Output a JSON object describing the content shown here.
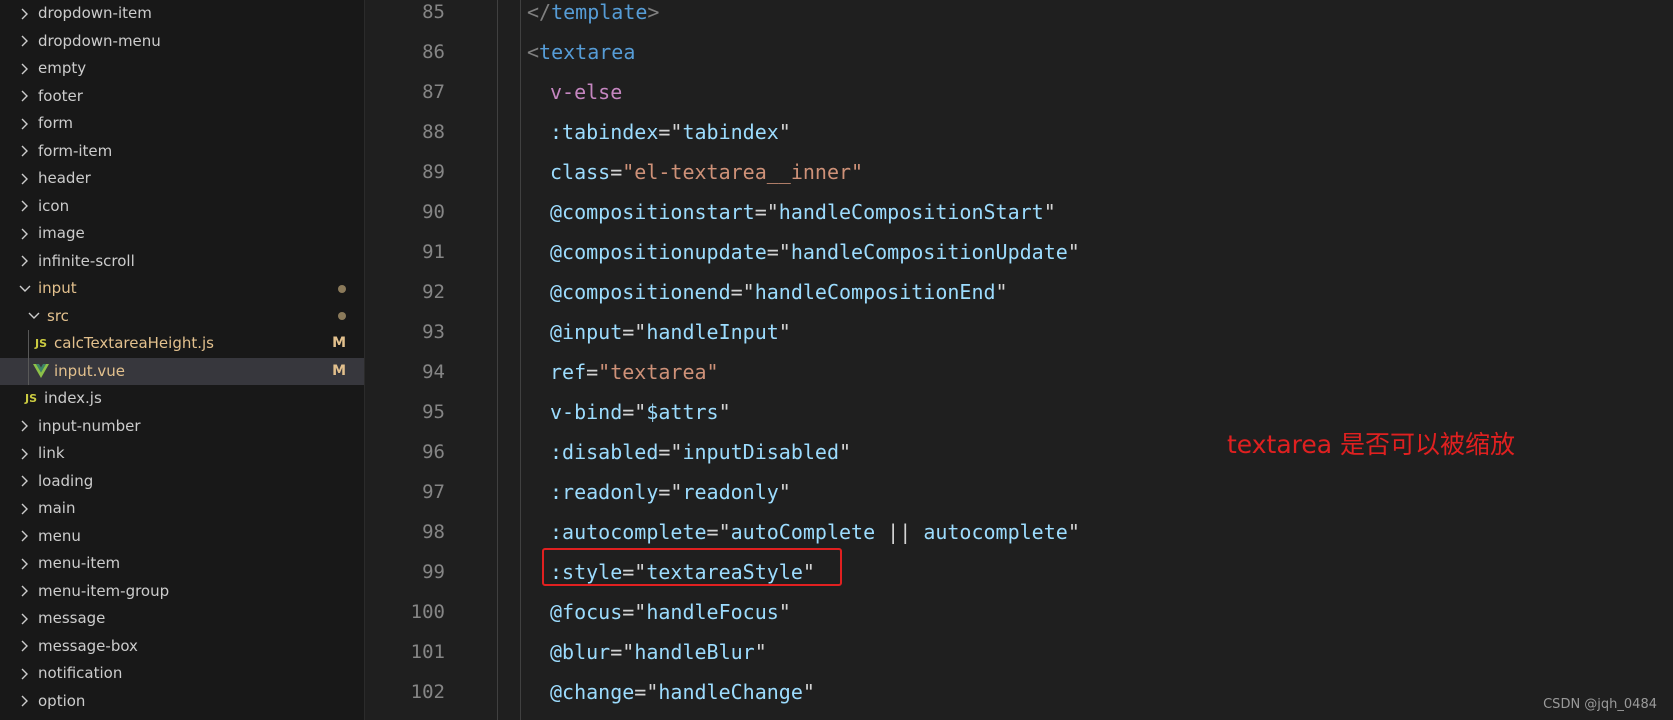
{
  "explorer": {
    "items": [
      {
        "label": "dropdown-item",
        "kind": "folder",
        "level": 0,
        "expanded": false
      },
      {
        "label": "dropdown-menu",
        "kind": "folder",
        "level": 0,
        "expanded": false
      },
      {
        "label": "empty",
        "kind": "folder",
        "level": 0,
        "expanded": false
      },
      {
        "label": "footer",
        "kind": "folder",
        "level": 0,
        "expanded": false
      },
      {
        "label": "form",
        "kind": "folder",
        "level": 0,
        "expanded": false
      },
      {
        "label": "form-item",
        "kind": "folder",
        "level": 0,
        "expanded": false
      },
      {
        "label": "header",
        "kind": "folder",
        "level": 0,
        "expanded": false
      },
      {
        "label": "icon",
        "kind": "folder",
        "level": 0,
        "expanded": false
      },
      {
        "label": "image",
        "kind": "folder",
        "level": 0,
        "expanded": false
      },
      {
        "label": "infinite-scroll",
        "kind": "folder",
        "level": 0,
        "expanded": false
      },
      {
        "label": "input",
        "kind": "folder",
        "level": 0,
        "expanded": true,
        "decoration": "dot"
      },
      {
        "label": "src",
        "kind": "folder",
        "level": 1,
        "expanded": true,
        "decoration": "dot"
      },
      {
        "label": "calcTextareaHeight.js",
        "kind": "js",
        "level": 2,
        "decoration": "M"
      },
      {
        "label": "input.vue",
        "kind": "vue",
        "level": 2,
        "decoration": "M",
        "selected": true
      },
      {
        "label": "index.js",
        "kind": "js",
        "level": 1
      },
      {
        "label": "input-number",
        "kind": "folder",
        "level": 0,
        "expanded": false
      },
      {
        "label": "link",
        "kind": "folder",
        "level": 0,
        "expanded": false
      },
      {
        "label": "loading",
        "kind": "folder",
        "level": 0,
        "expanded": false
      },
      {
        "label": "main",
        "kind": "folder",
        "level": 0,
        "expanded": false
      },
      {
        "label": "menu",
        "kind": "folder",
        "level": 0,
        "expanded": false
      },
      {
        "label": "menu-item",
        "kind": "folder",
        "level": 0,
        "expanded": false
      },
      {
        "label": "menu-item-group",
        "kind": "folder",
        "level": 0,
        "expanded": false
      },
      {
        "label": "message",
        "kind": "folder",
        "level": 0,
        "expanded": false
      },
      {
        "label": "message-box",
        "kind": "folder",
        "level": 0,
        "expanded": false
      },
      {
        "label": "notification",
        "kind": "folder",
        "level": 0,
        "expanded": false
      },
      {
        "label": "option",
        "kind": "folder",
        "level": 0,
        "expanded": false
      }
    ],
    "js_badge": "JS",
    "vue_badge": "V"
  },
  "editor": {
    "lines": [
      {
        "num": "85",
        "indent": 0,
        "tokens": [
          [
            "punc",
            "</"
          ],
          [
            "tag",
            "template"
          ],
          [
            "punc",
            ">"
          ]
        ]
      },
      {
        "num": "86",
        "indent": 0,
        "tokens": [
          [
            "punc",
            "<"
          ],
          [
            "tag",
            "textarea"
          ]
        ]
      },
      {
        "num": "87",
        "indent": 1,
        "tokens": [
          [
            "dir",
            "v-else"
          ]
        ]
      },
      {
        "num": "88",
        "indent": 1,
        "tokens": [
          [
            "attr",
            ":tabindex"
          ],
          [
            "eq",
            "="
          ],
          [
            "eq",
            "\""
          ],
          [
            "expr",
            "tabindex"
          ],
          [
            "eq",
            "\""
          ]
        ]
      },
      {
        "num": "89",
        "indent": 1,
        "tokens": [
          [
            "attr",
            "class"
          ],
          [
            "eq",
            "="
          ],
          [
            "str",
            "\"el-textarea__inner\""
          ]
        ]
      },
      {
        "num": "90",
        "indent": 1,
        "tokens": [
          [
            "attr",
            "@compositionstart"
          ],
          [
            "eq",
            "="
          ],
          [
            "eq",
            "\""
          ],
          [
            "expr",
            "handleCompositionStart"
          ],
          [
            "eq",
            "\""
          ]
        ]
      },
      {
        "num": "91",
        "indent": 1,
        "tokens": [
          [
            "attr",
            "@compositionupdate"
          ],
          [
            "eq",
            "="
          ],
          [
            "eq",
            "\""
          ],
          [
            "expr",
            "handleCompositionUpdate"
          ],
          [
            "eq",
            "\""
          ]
        ]
      },
      {
        "num": "92",
        "indent": 1,
        "tokens": [
          [
            "attr",
            "@compositionend"
          ],
          [
            "eq",
            "="
          ],
          [
            "eq",
            "\""
          ],
          [
            "expr",
            "handleCompositionEnd"
          ],
          [
            "eq",
            "\""
          ]
        ]
      },
      {
        "num": "93",
        "indent": 1,
        "tokens": [
          [
            "attr",
            "@input"
          ],
          [
            "eq",
            "="
          ],
          [
            "eq",
            "\""
          ],
          [
            "expr",
            "handleInput"
          ],
          [
            "eq",
            "\""
          ]
        ]
      },
      {
        "num": "94",
        "indent": 1,
        "tokens": [
          [
            "attr",
            "ref"
          ],
          [
            "eq",
            "="
          ],
          [
            "str",
            "\"textarea\""
          ]
        ]
      },
      {
        "num": "95",
        "indent": 1,
        "tokens": [
          [
            "attr",
            "v-bind"
          ],
          [
            "eq",
            "="
          ],
          [
            "eq",
            "\""
          ],
          [
            "expr",
            "$attrs"
          ],
          [
            "eq",
            "\""
          ]
        ]
      },
      {
        "num": "96",
        "indent": 1,
        "tokens": [
          [
            "attr",
            ":disabled"
          ],
          [
            "eq",
            "="
          ],
          [
            "eq",
            "\""
          ],
          [
            "expr",
            "inputDisabled"
          ],
          [
            "eq",
            "\""
          ]
        ]
      },
      {
        "num": "97",
        "indent": 1,
        "tokens": [
          [
            "attr",
            ":readonly"
          ],
          [
            "eq",
            "="
          ],
          [
            "eq",
            "\""
          ],
          [
            "expr",
            "readonly"
          ],
          [
            "eq",
            "\""
          ]
        ]
      },
      {
        "num": "98",
        "indent": 1,
        "tokens": [
          [
            "attr",
            ":autocomplete"
          ],
          [
            "eq",
            "="
          ],
          [
            "eq",
            "\""
          ],
          [
            "expr",
            "autoComplete"
          ],
          [
            "op",
            " || "
          ],
          [
            "expr",
            "autocomplete"
          ],
          [
            "eq",
            "\""
          ]
        ]
      },
      {
        "num": "99",
        "indent": 1,
        "tokens": [
          [
            "attr",
            ":style"
          ],
          [
            "eq",
            "="
          ],
          [
            "eq",
            "\""
          ],
          [
            "expr",
            "textareaStyle"
          ],
          [
            "eq",
            "\""
          ]
        ]
      },
      {
        "num": "100",
        "indent": 1,
        "tokens": [
          [
            "attr",
            "@focus"
          ],
          [
            "eq",
            "="
          ],
          [
            "eq",
            "\""
          ],
          [
            "expr",
            "handleFocus"
          ],
          [
            "eq",
            "\""
          ]
        ]
      },
      {
        "num": "101",
        "indent": 1,
        "tokens": [
          [
            "attr",
            "@blur"
          ],
          [
            "eq",
            "="
          ],
          [
            "eq",
            "\""
          ],
          [
            "expr",
            "handleBlur"
          ],
          [
            "eq",
            "\""
          ]
        ]
      },
      {
        "num": "102",
        "indent": 1,
        "tokens": [
          [
            "attr",
            "@change"
          ],
          [
            "eq",
            "="
          ],
          [
            "eq",
            "\""
          ],
          [
            "expr",
            "handleChange"
          ],
          [
            "eq",
            "\""
          ]
        ]
      }
    ]
  },
  "annotation": {
    "text": "textarea 是否可以被缩放",
    "color": "#e02020"
  },
  "watermark": "CSDN @jqh_0484",
  "colors": {
    "background": "#1f1f1f",
    "sidebar": "#181818",
    "selected_row": "#37373d",
    "modified": "#e2c08d",
    "tag": "#569cd6",
    "attribute": "#9cdcfe",
    "string": "#ce9178",
    "directive": "#c586c0"
  }
}
